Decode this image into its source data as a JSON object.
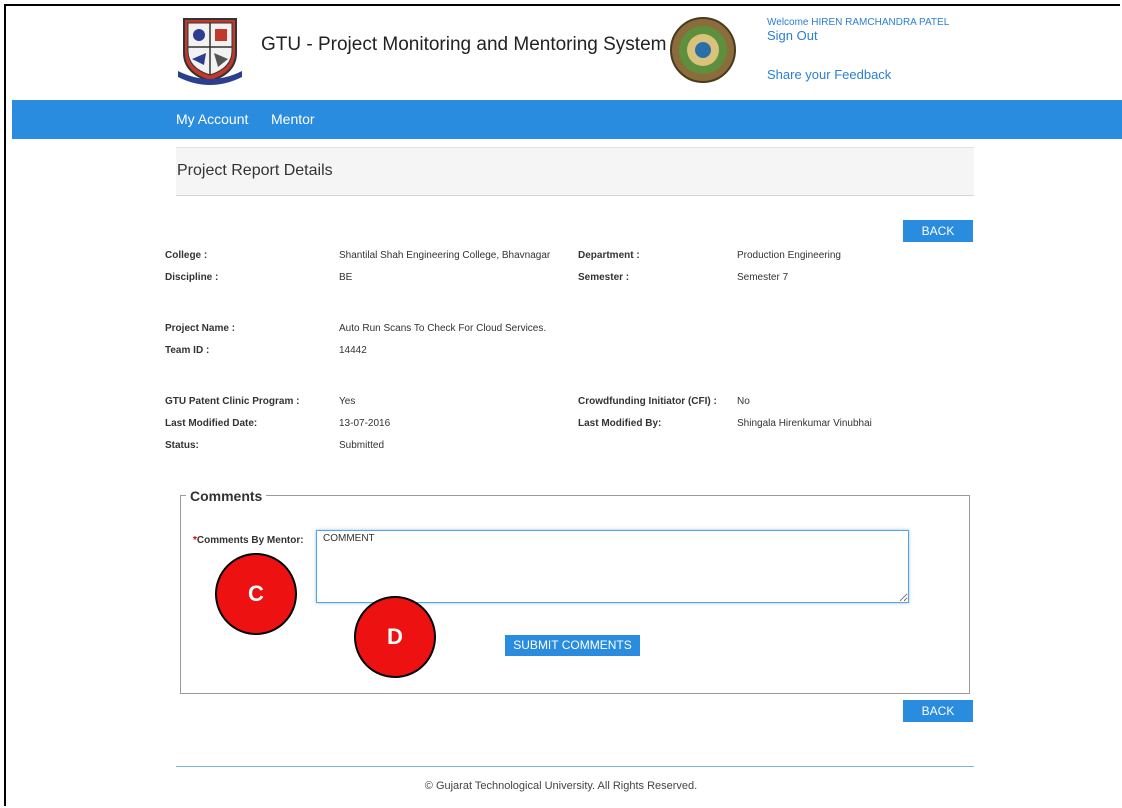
{
  "header": {
    "site_title": "GTU - Project Monitoring and Mentoring System",
    "welcome_text": "Welcome HIREN RAMCHANDRA PATEL",
    "sign_out": "Sign Out",
    "feedback": "Share your Feedback"
  },
  "nav": {
    "items": [
      "My Account",
      "Mentor"
    ]
  },
  "page": {
    "title": "Project Report Details",
    "back_label": "BACK"
  },
  "details": {
    "college_label": "College :",
    "college_value": "Shantilal Shah Engineering College, Bhavnagar",
    "department_label": "Department :",
    "department_value": "Production Engineering",
    "discipline_label": "Discipline :",
    "discipline_value": "BE",
    "semester_label": "Semester :",
    "semester_value": "Semester 7",
    "project_name_label": "Project Name :",
    "project_name_value": "Auto Run Scans To Check For Cloud Services.",
    "team_id_label": "Team ID :",
    "team_id_value": "14442",
    "patent_label": "GTU Patent Clinic Program :",
    "patent_value": "Yes",
    "cfi_label": "Crowdfunding Initiator (CFI) :",
    "cfi_value": "No",
    "modified_date_label": "Last Modified Date:",
    "modified_date_value": "13-07-2016",
    "modified_by_label": "Last Modified By:",
    "modified_by_value": "Shingala Hirenkumar Vinubhai",
    "status_label": "Status:",
    "status_value": "Submitted"
  },
  "comments": {
    "legend": "Comments",
    "required_mark": "*",
    "label": "Comments By Mentor:",
    "value": "COMMENT",
    "submit_label": "SUBMIT COMMENTS"
  },
  "markers": {
    "c": "C",
    "d": "D"
  },
  "footer": {
    "copyright": "© Gujarat Technological University. All Rights Reserved."
  },
  "colors": {
    "accent": "#2a8cde",
    "marker": "#ee1111",
    "link": "#2a7fd4"
  }
}
